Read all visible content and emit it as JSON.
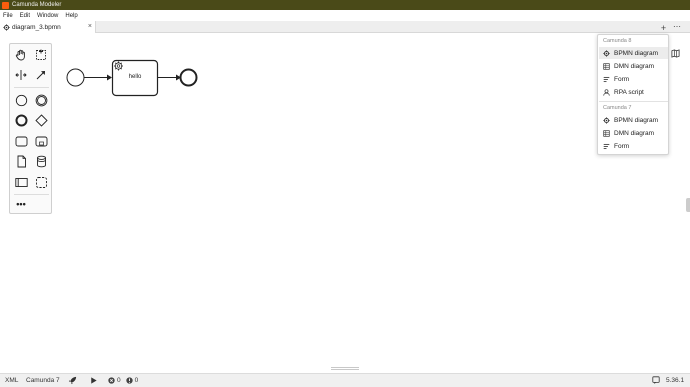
{
  "window": {
    "title": "Camunda Modeler"
  },
  "menu": [
    "File",
    "Edit",
    "Window",
    "Help"
  ],
  "tabs": [
    {
      "label": "diagram_3.bpmn",
      "close": "×"
    }
  ],
  "tabbar": {
    "add_label": "+",
    "more_label": "⋯"
  },
  "diagram": {
    "task_label": "hello"
  },
  "palette": {
    "more_label": "•••"
  },
  "new_file_menu": {
    "groups": [
      {
        "label": "Camunda 8",
        "items": [
          {
            "label": "BPMN diagram",
            "icon": "bpmn-icon"
          },
          {
            "label": "DMN diagram",
            "icon": "dmn-icon"
          },
          {
            "label": "Form",
            "icon": "form-icon"
          },
          {
            "label": "RPA script",
            "icon": "rpa-icon"
          }
        ]
      },
      {
        "label": "Camunda 7",
        "items": [
          {
            "label": "BPMN diagram",
            "icon": "bpmn-icon"
          },
          {
            "label": "DMN diagram",
            "icon": "dmn-icon"
          },
          {
            "label": "Form",
            "icon": "form-icon"
          }
        ]
      }
    ]
  },
  "statusbar": {
    "xml_label": "XML",
    "engine_label": "Camunda 7",
    "errors": "0",
    "warnings": "0",
    "version": "5.36.1"
  },
  "colors": {
    "titlebar": "#4a4a18",
    "app_icon": "#fc5d0d",
    "accent": "#fc5d0d"
  }
}
